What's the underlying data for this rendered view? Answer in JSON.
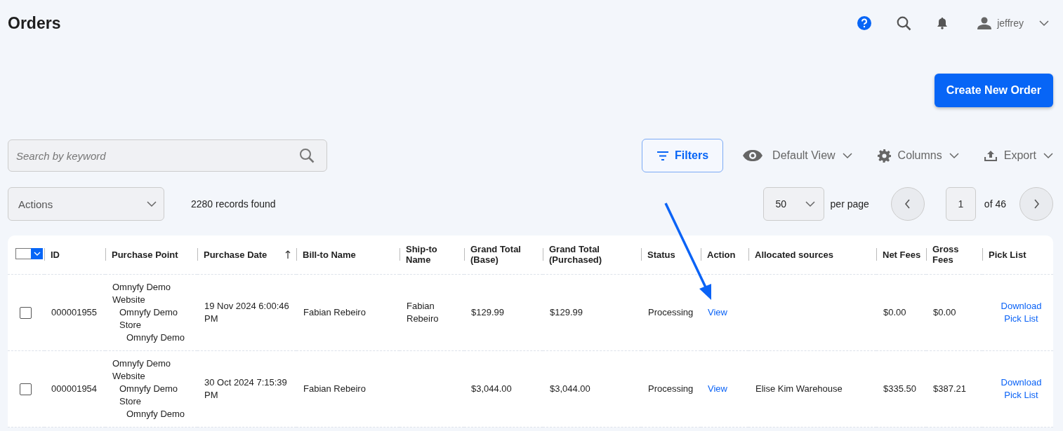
{
  "page": {
    "title": "Orders"
  },
  "header": {
    "user_name": "jeffrey"
  },
  "create_button": "Create New Order",
  "search": {
    "placeholder": "Search by keyword"
  },
  "toolbar": {
    "filters": "Filters",
    "view": "Default View",
    "columns": "Columns",
    "export": "Export"
  },
  "actions": {
    "label": "Actions"
  },
  "records_found": "2280 records found",
  "pagination": {
    "per_page_value": "50",
    "per_page_label": "per page",
    "page": "1",
    "of_pages": "of 46"
  },
  "table": {
    "select_all": {
      "checked": false
    },
    "columns": [
      {
        "label": "ID",
        "sorted": false
      },
      {
        "label": "Purchase Point",
        "sorted": false
      },
      {
        "label": "Purchase Date",
        "sorted": true
      },
      {
        "label": "Bill-to Name",
        "sorted": false
      },
      {
        "label": "Ship-to Name",
        "sorted": false
      },
      {
        "label": "Grand Total (Base)",
        "sorted": false
      },
      {
        "label": "Grand Total (Purchased)",
        "sorted": false
      },
      {
        "label": "Status",
        "sorted": false
      },
      {
        "label": "Action",
        "sorted": false
      },
      {
        "label": "Allocated sources",
        "sorted": false
      },
      {
        "label": "Net Fees",
        "sorted": false
      },
      {
        "label": "Gross Fees",
        "sorted": false
      },
      {
        "label": "Pick List",
        "sorted": false
      }
    ],
    "rows": [
      {
        "checked": false,
        "id": "000001955",
        "purchase_point": {
          "text": "Omnyfy Demo Website",
          "children": [
            {
              "text": "Omnyfy Demo Store",
              "children": [
                {
                  "text": "Omnyfy Demo"
                }
              ]
            }
          ]
        },
        "purchase_date": "19 Nov 2024 6:00:46 PM",
        "bill_to": "Fabian Rebeiro",
        "ship_to": "Fabian Rebeiro",
        "grand_total_base": "$129.99",
        "grand_total_purchased": "$129.99",
        "status": "Processing",
        "action": "View",
        "allocated_sources": "",
        "net_fees": "$0.00",
        "gross_fees": "$0.00",
        "pick_list": "Download Pick List"
      },
      {
        "checked": false,
        "id": "000001954",
        "purchase_point": {
          "text": "Omnyfy Demo Website",
          "children": [
            {
              "text": "Omnyfy Demo Store",
              "children": [
                {
                  "text": "Omnyfy Demo"
                }
              ]
            }
          ]
        },
        "purchase_date": "30 Oct 2024 7:15:39 PM",
        "bill_to": "Fabian Rebeiro",
        "ship_to": "",
        "grand_total_base": "$3,044.00",
        "grand_total_purchased": "$3,044.00",
        "status": "Processing",
        "action": "View",
        "allocated_sources": "Elise Kim Warehouse",
        "net_fees": "$335.50",
        "gross_fees": "$387.21",
        "pick_list": "Download Pick List"
      }
    ]
  }
}
